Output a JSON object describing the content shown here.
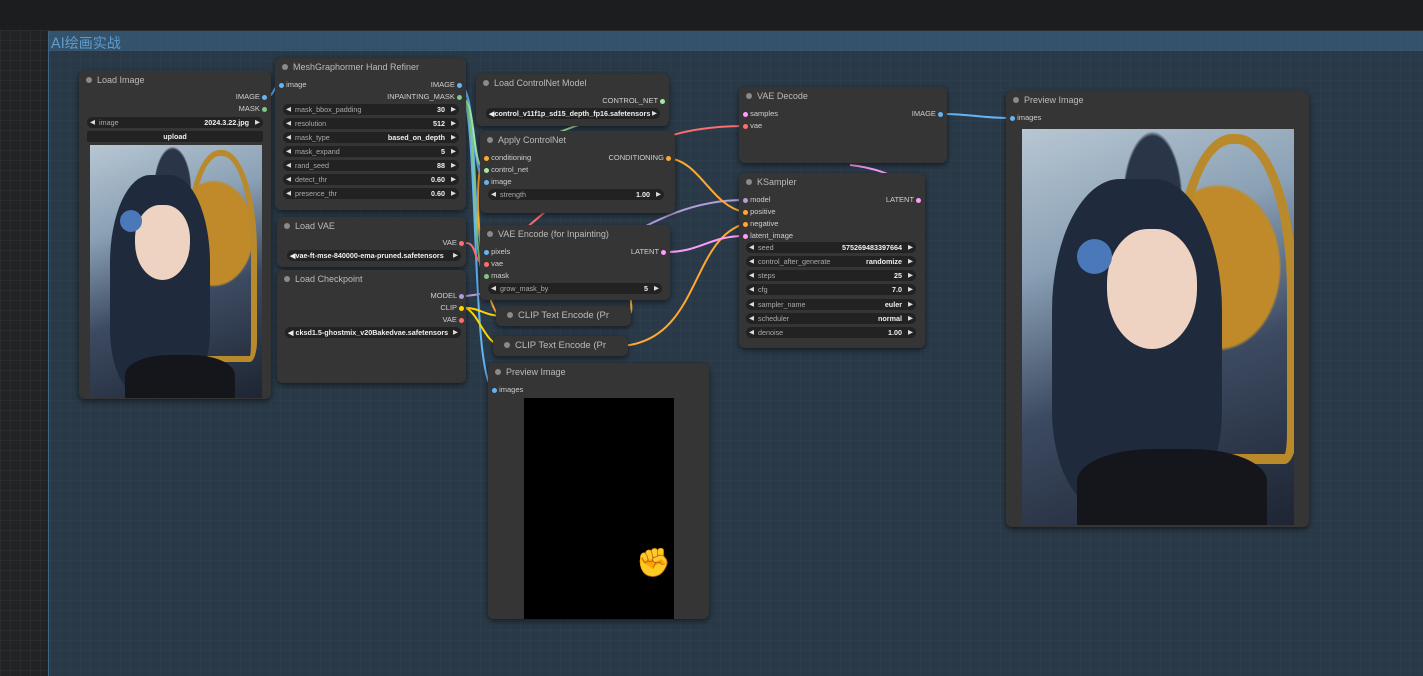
{
  "group": {
    "title": "AI绘画实战"
  },
  "load_image": {
    "title": "Load Image",
    "outputs": [
      "IMAGE",
      "MASK"
    ],
    "image_label": "image",
    "image_value": "2024.3.22.jpg",
    "upload_label": "upload"
  },
  "hand_refiner": {
    "title": "MeshGraphormer Hand Refiner",
    "input": "image",
    "outputs": [
      "IMAGE",
      "INPAINTING_MASK"
    ],
    "widgets": [
      {
        "label": "mask_bbox_padding",
        "value": "30"
      },
      {
        "label": "resolution",
        "value": "512"
      },
      {
        "label": "mask_type",
        "value": "based_on_depth"
      },
      {
        "label": "mask_expand",
        "value": "5"
      },
      {
        "label": "rand_seed",
        "value": "88"
      },
      {
        "label": "detect_thr",
        "value": "0.60"
      },
      {
        "label": "presence_thr",
        "value": "0.60"
      }
    ]
  },
  "load_vae": {
    "title": "Load VAE",
    "output": "VAE",
    "widget_value": "vae-ft-mse-840000-ema-pruned.safetensors",
    "widget_overlap": "◀vae-ft-mse-840000-ema-pruned.safetensors"
  },
  "load_checkpoint": {
    "title": "Load Checkpoint",
    "outputs": [
      "MODEL",
      "CLIP",
      "VAE"
    ],
    "widget_value": "sd15-ghostmix_v20Bakedvae.safetensors",
    "widget_overlap": "◀ cksd1.5-ghostmix_v20Bakedvae.safetensors"
  },
  "controlnet_loader": {
    "title": "Load ControlNet Model",
    "output": "CONTROL_NET",
    "widget_value": "control_v11f1p_sd15_depth_fp16.safetensors",
    "widget_overlap": "◀control_v11f1p_sd15_depth_fp16.safetensors"
  },
  "apply_controlnet": {
    "title": "Apply ControlNet",
    "inputs": [
      "conditioning",
      "control_net",
      "image"
    ],
    "output": "CONDITIONING",
    "widget_label": "strength",
    "widget_value": "1.00"
  },
  "vae_encode": {
    "title": "VAE Encode (for Inpainting)",
    "inputs": [
      "pixels",
      "vae",
      "mask"
    ],
    "output": "LATENT",
    "widget_label": "grow_mask_by",
    "widget_value": "5"
  },
  "clip_text_1": {
    "title": "CLIP Text Encode (Pr"
  },
  "clip_text_2": {
    "title": "CLIP Text Encode (Pr"
  },
  "preview_mask": {
    "title": "Preview Image",
    "input": "images"
  },
  "vae_decode": {
    "title": "VAE Decode",
    "inputs": [
      "samples",
      "vae"
    ],
    "output": "IMAGE"
  },
  "ksampler": {
    "title": "KSampler",
    "inputs": [
      "model",
      "positive",
      "negative",
      "latent_image"
    ],
    "output": "LATENT",
    "widgets": [
      {
        "label": "seed",
        "value": "575269483397664"
      },
      {
        "label": "control_after_generate",
        "value": "randomize"
      },
      {
        "label": "steps",
        "value": "25"
      },
      {
        "label": "cfg",
        "value": "7.0"
      },
      {
        "label": "sampler_name",
        "value": "euler"
      },
      {
        "label": "scheduler",
        "value": "normal"
      },
      {
        "label": "denoise",
        "value": "1.00"
      }
    ]
  },
  "preview_final": {
    "title": "Preview Image",
    "input": "images"
  },
  "icons": {
    "arrow_left": "◀",
    "arrow_right": "▶",
    "hand": "✊"
  },
  "colors": {
    "image": "#64b5f6",
    "mask": "#81c784",
    "vae": "#ff6e6e",
    "model": "#b39ddb",
    "clip": "#ffd500",
    "conditioning": "#ffa931",
    "latent": "#ff9cf9",
    "control_net": "#a5e8a5"
  }
}
